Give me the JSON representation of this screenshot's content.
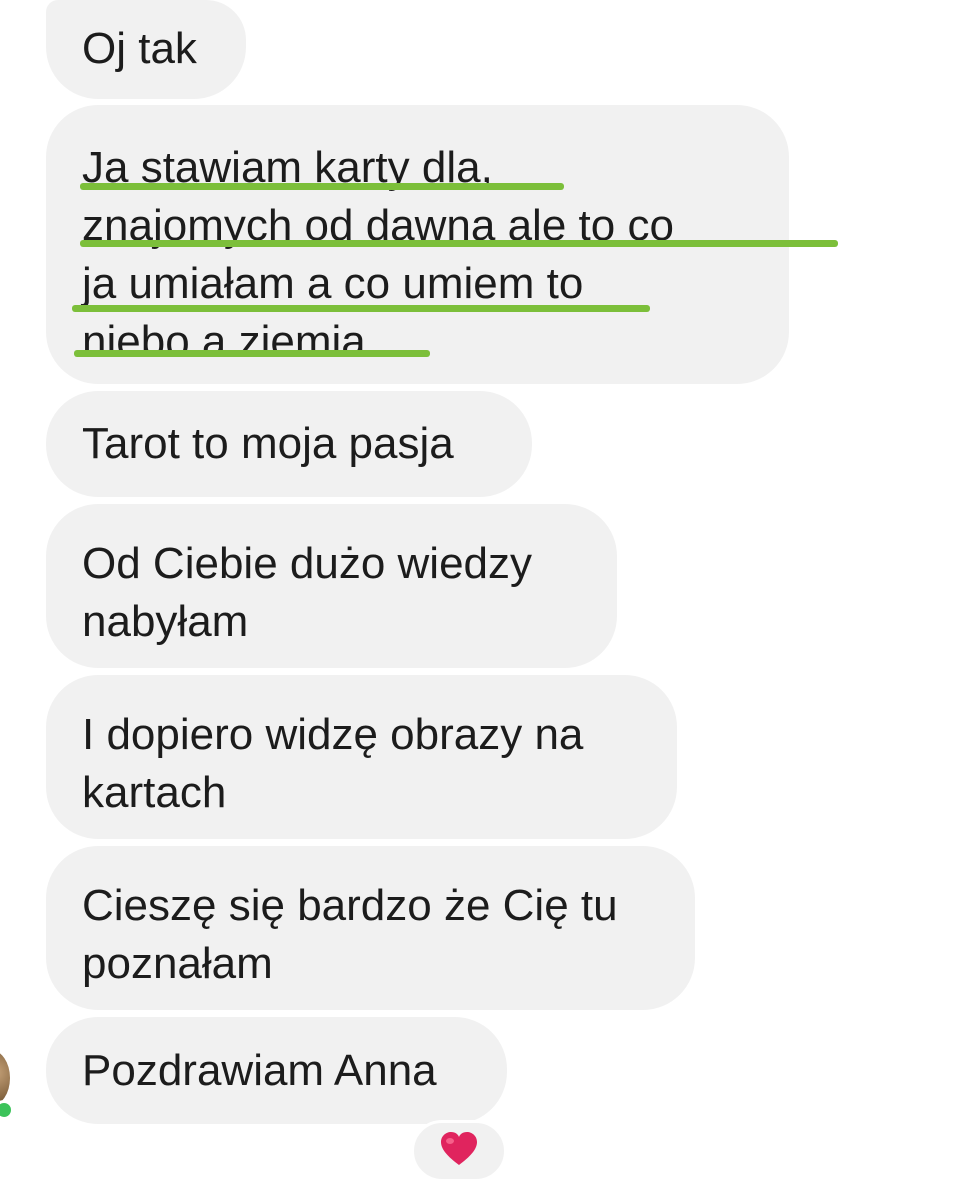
{
  "conversation": {
    "messages": [
      {
        "text": "Oj tak"
      },
      {
        "text": "Ja stawiam karty dla,\nznajomych od dawna ale to co\nja umiałam a co umiem to\nniebo a ziemia"
      },
      {
        "text": "Tarot to moja pasja"
      },
      {
        "text": "Od Ciebie dużo wiedzy\nnabyłam"
      },
      {
        "text": "I dopiero widzę obrazy na\nkartach"
      },
      {
        "text": "Cieszę się bardzo że Cię tu\npoznałam"
      },
      {
        "text": "Pozdrawiam Anna"
      }
    ],
    "reaction": {
      "icon": "red-heart-icon",
      "color": "#e0245e"
    },
    "highlight_color": "#7cbf3a",
    "bubble_color": "#f1f1f1",
    "online_status_color": "#3cc35a"
  }
}
